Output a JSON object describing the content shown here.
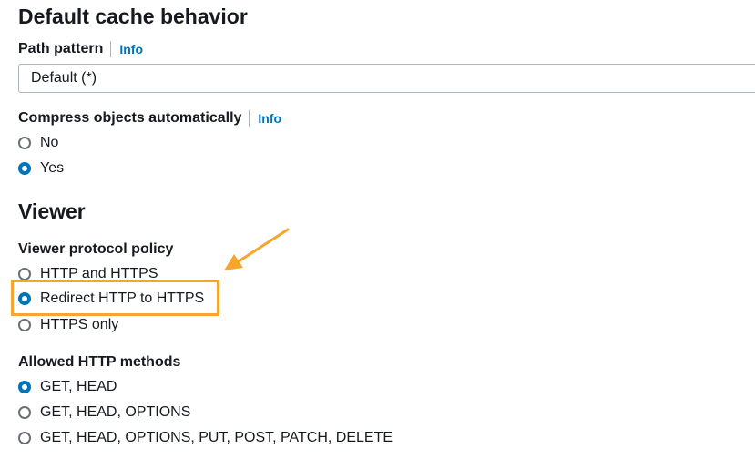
{
  "cache": {
    "heading": "Default cache behavior",
    "path_pattern": {
      "label": "Path pattern",
      "info": "Info",
      "value": "Default (*)"
    },
    "compress": {
      "label": "Compress objects automatically",
      "info": "Info",
      "options": [
        {
          "label": "No",
          "selected": false
        },
        {
          "label": "Yes",
          "selected": true
        }
      ]
    }
  },
  "viewer": {
    "heading": "Viewer",
    "protocol_policy": {
      "label": "Viewer protocol policy",
      "options": [
        {
          "label": "HTTP and HTTPS",
          "selected": false
        },
        {
          "label": "Redirect HTTP to HTTPS",
          "selected": true
        },
        {
          "label": "HTTPS only",
          "selected": false
        }
      ]
    },
    "allowed_methods": {
      "label": "Allowed HTTP methods",
      "options": [
        {
          "label": "GET, HEAD",
          "selected": true
        },
        {
          "label": "GET, HEAD, OPTIONS",
          "selected": false
        },
        {
          "label": "GET, HEAD, OPTIONS, PUT, POST, PATCH, DELETE",
          "selected": false
        }
      ]
    }
  },
  "colors": {
    "accent": "#0073bb",
    "annotation": "#f6a52d",
    "text": "#16191f"
  },
  "icons": {
    "annotation_arrow": "arrow-icon",
    "radio_selected": "radio-selected-icon",
    "radio_unselected": "radio-unselected-icon"
  }
}
